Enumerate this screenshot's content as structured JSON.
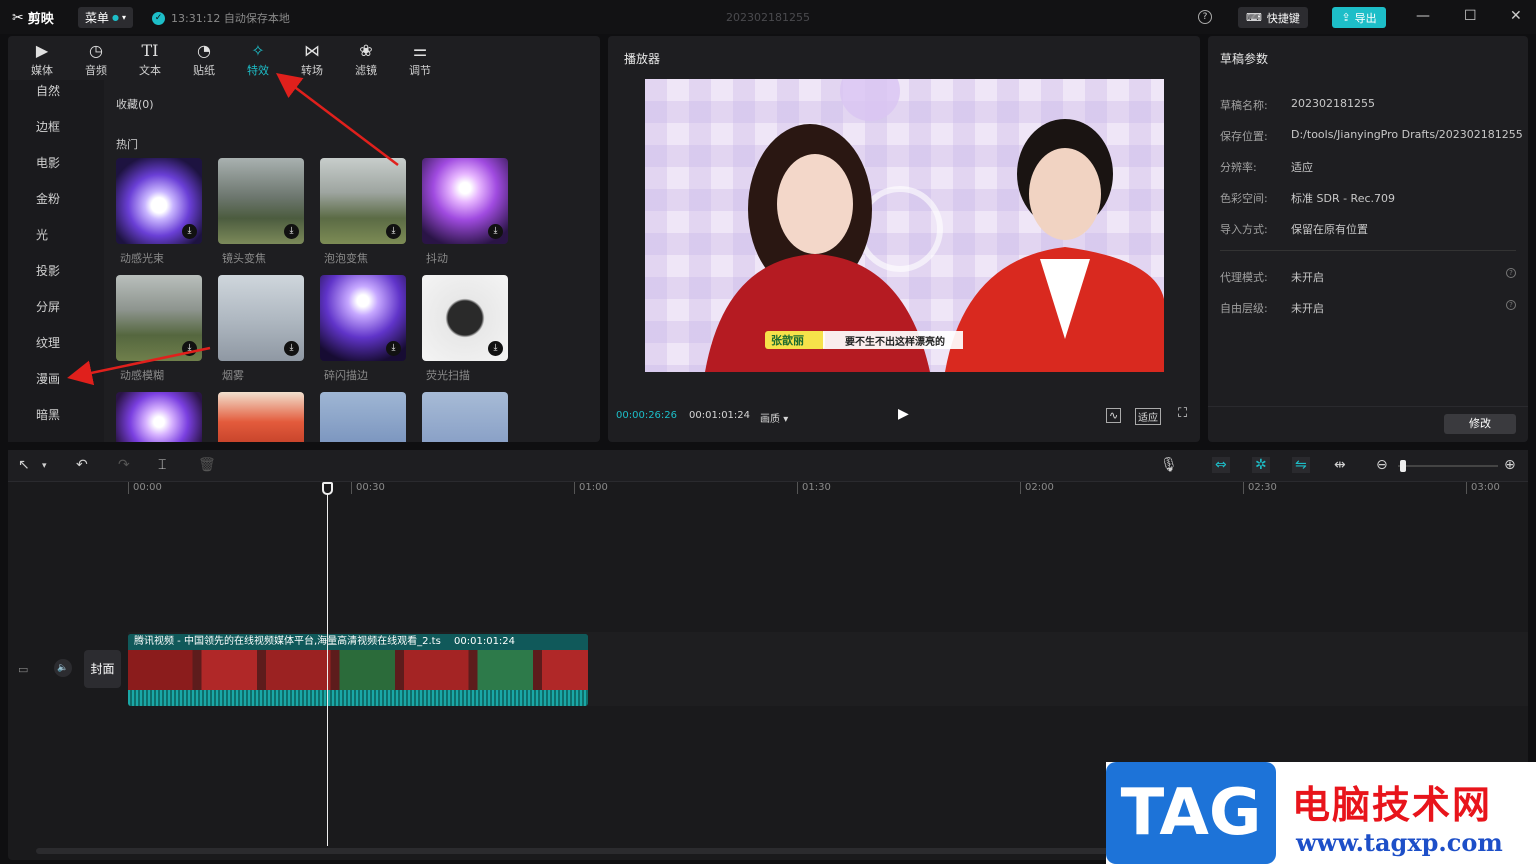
{
  "app": {
    "logo_text": "剪映",
    "menu_label": "菜单",
    "autosave_text": "13:31:12 自动保存本地",
    "project_title": "202302181255",
    "shortcut_label": "快捷键",
    "export_label": "导出",
    "accent_color": "#1dbec8"
  },
  "toolbar": {
    "tabs": [
      {
        "label": "媒体",
        "icon": "media-icon"
      },
      {
        "label": "音频",
        "icon": "audio-icon"
      },
      {
        "label": "文本",
        "icon": "text-icon"
      },
      {
        "label": "贴纸",
        "icon": "sticker-icon"
      },
      {
        "label": "特效",
        "icon": "effects-icon",
        "active": true
      },
      {
        "label": "转场",
        "icon": "transition-icon"
      },
      {
        "label": "滤镜",
        "icon": "filter-icon"
      },
      {
        "label": "调节",
        "icon": "adjust-icon"
      }
    ]
  },
  "categories": [
    "自然",
    "边框",
    "电影",
    "金粉",
    "光",
    "投影",
    "分屏",
    "纹理",
    "漫画",
    "暗黑"
  ],
  "effects": {
    "favorites_label": "收藏(0)",
    "hot_label": "热门",
    "items": [
      {
        "label": "动感光束"
      },
      {
        "label": "镜头变焦"
      },
      {
        "label": "泡泡变焦"
      },
      {
        "label": "抖动"
      },
      {
        "label": "动感模糊"
      },
      {
        "label": "烟雾"
      },
      {
        "label": "碎闪描边"
      },
      {
        "label": "荧光扫描"
      }
    ]
  },
  "player": {
    "title": "播放器",
    "current_time": "00:00:26:26",
    "total_time": "00:01:01:24",
    "quality_label": "画质",
    "fit_label": "适应",
    "caption_name": "张歆丽",
    "caption_text": "要不生不出这样漂亮的"
  },
  "draft": {
    "title": "草稿参数",
    "fields": [
      {
        "key": "草稿名称:",
        "value": "202302181255"
      },
      {
        "key": "保存位置:",
        "value": "D:/tools/JianyingPro Drafts/202302181255"
      },
      {
        "key": "分辨率:",
        "value": "适应"
      },
      {
        "key": "色彩空间:",
        "value": "标准 SDR - Rec.709"
      },
      {
        "key": "导入方式:",
        "value": "保留在原有位置"
      }
    ],
    "fields2": [
      {
        "key": "代理模式:",
        "value": "未开启"
      },
      {
        "key": "自由层级:",
        "value": "未开启"
      }
    ],
    "modify_label": "修改"
  },
  "timeline": {
    "ticks": [
      "00:00",
      "00:30",
      "01:00",
      "01:30",
      "02:00",
      "02:30",
      "03:00"
    ],
    "clip_title": "腾讯视频 - 中国领先的在线视频媒体平台,海量高清视频在线观看_2.ts",
    "clip_duration": "00:01:01:24",
    "cover_label": "封面"
  },
  "watermark": {
    "tag": "TAG",
    "cn": "电脑技术网",
    "url": "www.tagxp.com"
  }
}
